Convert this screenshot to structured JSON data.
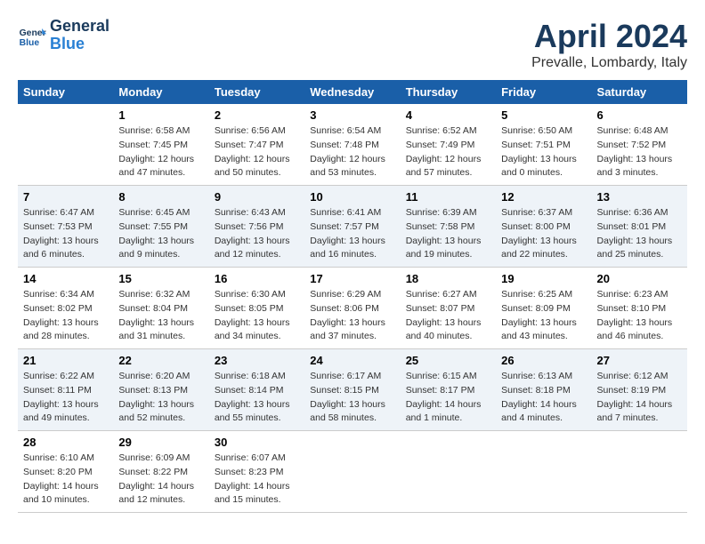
{
  "header": {
    "logo_line1": "General",
    "logo_line2": "Blue",
    "month": "April 2024",
    "location": "Prevalle, Lombardy, Italy"
  },
  "columns": [
    "Sunday",
    "Monday",
    "Tuesday",
    "Wednesday",
    "Thursday",
    "Friday",
    "Saturday"
  ],
  "weeks": [
    [
      {
        "day": "",
        "info": ""
      },
      {
        "day": "1",
        "info": "Sunrise: 6:58 AM\nSunset: 7:45 PM\nDaylight: 12 hours\nand 47 minutes."
      },
      {
        "day": "2",
        "info": "Sunrise: 6:56 AM\nSunset: 7:47 PM\nDaylight: 12 hours\nand 50 minutes."
      },
      {
        "day": "3",
        "info": "Sunrise: 6:54 AM\nSunset: 7:48 PM\nDaylight: 12 hours\nand 53 minutes."
      },
      {
        "day": "4",
        "info": "Sunrise: 6:52 AM\nSunset: 7:49 PM\nDaylight: 12 hours\nand 57 minutes."
      },
      {
        "day": "5",
        "info": "Sunrise: 6:50 AM\nSunset: 7:51 PM\nDaylight: 13 hours\nand 0 minutes."
      },
      {
        "day": "6",
        "info": "Sunrise: 6:48 AM\nSunset: 7:52 PM\nDaylight: 13 hours\nand 3 minutes."
      }
    ],
    [
      {
        "day": "7",
        "info": "Sunrise: 6:47 AM\nSunset: 7:53 PM\nDaylight: 13 hours\nand 6 minutes."
      },
      {
        "day": "8",
        "info": "Sunrise: 6:45 AM\nSunset: 7:55 PM\nDaylight: 13 hours\nand 9 minutes."
      },
      {
        "day": "9",
        "info": "Sunrise: 6:43 AM\nSunset: 7:56 PM\nDaylight: 13 hours\nand 12 minutes."
      },
      {
        "day": "10",
        "info": "Sunrise: 6:41 AM\nSunset: 7:57 PM\nDaylight: 13 hours\nand 16 minutes."
      },
      {
        "day": "11",
        "info": "Sunrise: 6:39 AM\nSunset: 7:58 PM\nDaylight: 13 hours\nand 19 minutes."
      },
      {
        "day": "12",
        "info": "Sunrise: 6:37 AM\nSunset: 8:00 PM\nDaylight: 13 hours\nand 22 minutes."
      },
      {
        "day": "13",
        "info": "Sunrise: 6:36 AM\nSunset: 8:01 PM\nDaylight: 13 hours\nand 25 minutes."
      }
    ],
    [
      {
        "day": "14",
        "info": "Sunrise: 6:34 AM\nSunset: 8:02 PM\nDaylight: 13 hours\nand 28 minutes."
      },
      {
        "day": "15",
        "info": "Sunrise: 6:32 AM\nSunset: 8:04 PM\nDaylight: 13 hours\nand 31 minutes."
      },
      {
        "day": "16",
        "info": "Sunrise: 6:30 AM\nSunset: 8:05 PM\nDaylight: 13 hours\nand 34 minutes."
      },
      {
        "day": "17",
        "info": "Sunrise: 6:29 AM\nSunset: 8:06 PM\nDaylight: 13 hours\nand 37 minutes."
      },
      {
        "day": "18",
        "info": "Sunrise: 6:27 AM\nSunset: 8:07 PM\nDaylight: 13 hours\nand 40 minutes."
      },
      {
        "day": "19",
        "info": "Sunrise: 6:25 AM\nSunset: 8:09 PM\nDaylight: 13 hours\nand 43 minutes."
      },
      {
        "day": "20",
        "info": "Sunrise: 6:23 AM\nSunset: 8:10 PM\nDaylight: 13 hours\nand 46 minutes."
      }
    ],
    [
      {
        "day": "21",
        "info": "Sunrise: 6:22 AM\nSunset: 8:11 PM\nDaylight: 13 hours\nand 49 minutes."
      },
      {
        "day": "22",
        "info": "Sunrise: 6:20 AM\nSunset: 8:13 PM\nDaylight: 13 hours\nand 52 minutes."
      },
      {
        "day": "23",
        "info": "Sunrise: 6:18 AM\nSunset: 8:14 PM\nDaylight: 13 hours\nand 55 minutes."
      },
      {
        "day": "24",
        "info": "Sunrise: 6:17 AM\nSunset: 8:15 PM\nDaylight: 13 hours\nand 58 minutes."
      },
      {
        "day": "25",
        "info": "Sunrise: 6:15 AM\nSunset: 8:17 PM\nDaylight: 14 hours\nand 1 minute."
      },
      {
        "day": "26",
        "info": "Sunrise: 6:13 AM\nSunset: 8:18 PM\nDaylight: 14 hours\nand 4 minutes."
      },
      {
        "day": "27",
        "info": "Sunrise: 6:12 AM\nSunset: 8:19 PM\nDaylight: 14 hours\nand 7 minutes."
      }
    ],
    [
      {
        "day": "28",
        "info": "Sunrise: 6:10 AM\nSunset: 8:20 PM\nDaylight: 14 hours\nand 10 minutes."
      },
      {
        "day": "29",
        "info": "Sunrise: 6:09 AM\nSunset: 8:22 PM\nDaylight: 14 hours\nand 12 minutes."
      },
      {
        "day": "30",
        "info": "Sunrise: 6:07 AM\nSunset: 8:23 PM\nDaylight: 14 hours\nand 15 minutes."
      },
      {
        "day": "",
        "info": ""
      },
      {
        "day": "",
        "info": ""
      },
      {
        "day": "",
        "info": ""
      },
      {
        "day": "",
        "info": ""
      }
    ]
  ]
}
